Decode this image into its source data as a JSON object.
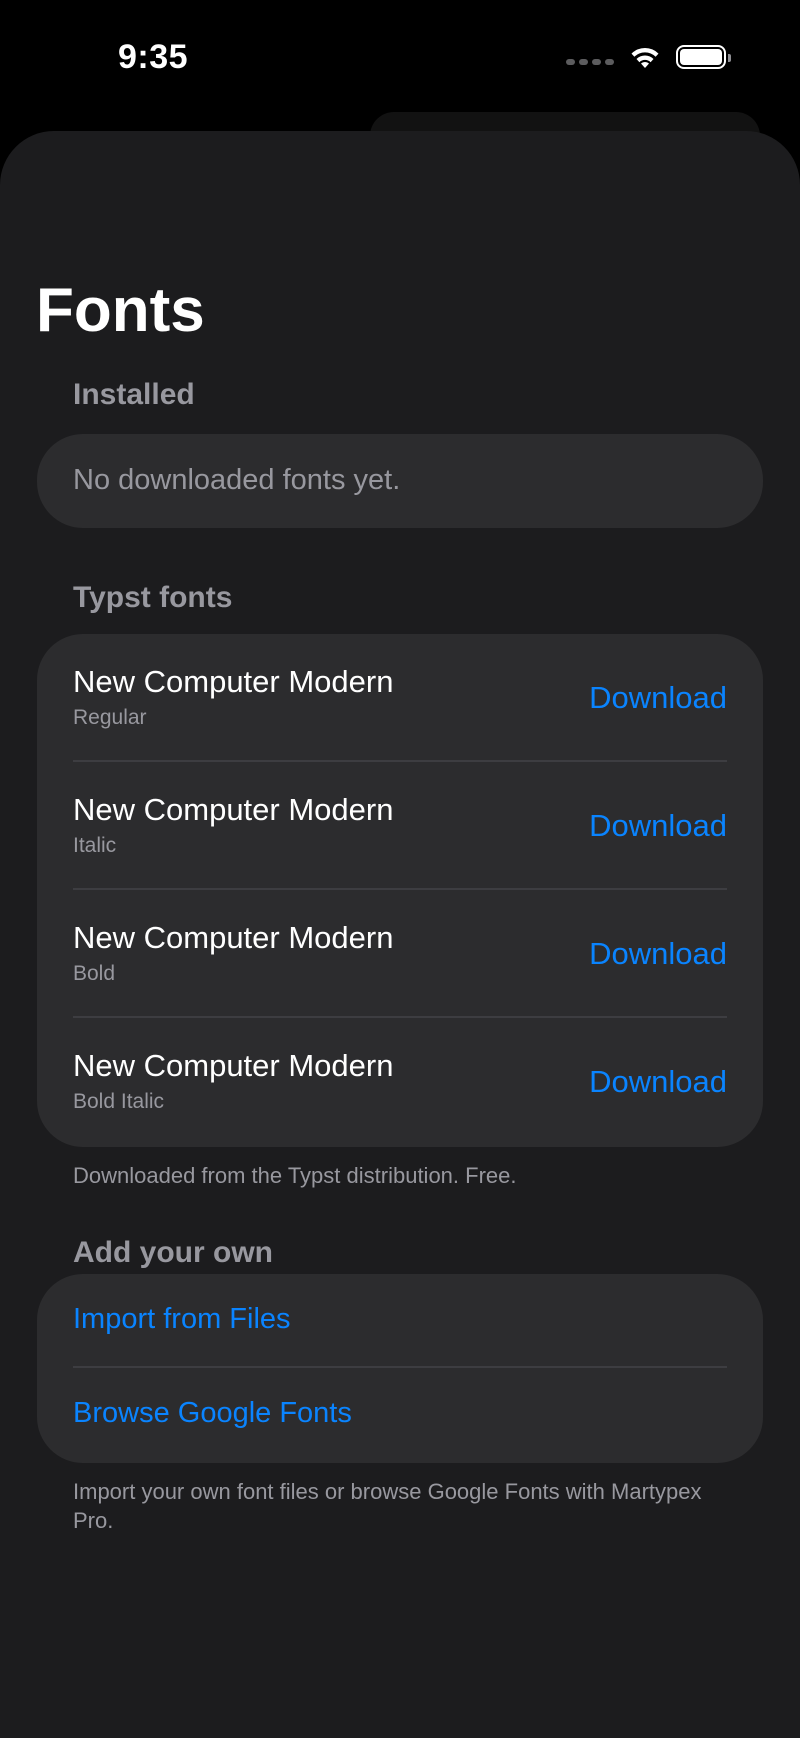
{
  "status_bar": {
    "time": "9:35"
  },
  "colors": {
    "accent": "#0a84ff",
    "sheet_background": "#1c1c1e",
    "card_background": "#2c2c2e",
    "secondary_text": "#98989f"
  },
  "page": {
    "title": "Fonts"
  },
  "installed": {
    "header": "Installed",
    "empty_text": "No downloaded fonts yet."
  },
  "typst_fonts": {
    "header": "Typst fonts",
    "items": [
      {
        "name": "New Computer Modern",
        "style": "Regular",
        "action": "Download"
      },
      {
        "name": "New Computer Modern",
        "style": "Italic",
        "action": "Download"
      },
      {
        "name": "New Computer Modern",
        "style": "Bold",
        "action": "Download"
      },
      {
        "name": "New Computer Modern",
        "style": "Bold Italic",
        "action": "Download"
      }
    ],
    "footer": "Downloaded from the Typst distribution. Free."
  },
  "add_your_own": {
    "header": "Add your own",
    "items": [
      {
        "label": "Import from Files"
      },
      {
        "label": "Browse Google Fonts"
      }
    ],
    "footer": "Import your own font files or browse Google Fonts with Martypex Pro."
  },
  "icons": [
    "cellular-signal-icon",
    "wifi-icon",
    "battery-icon"
  ]
}
